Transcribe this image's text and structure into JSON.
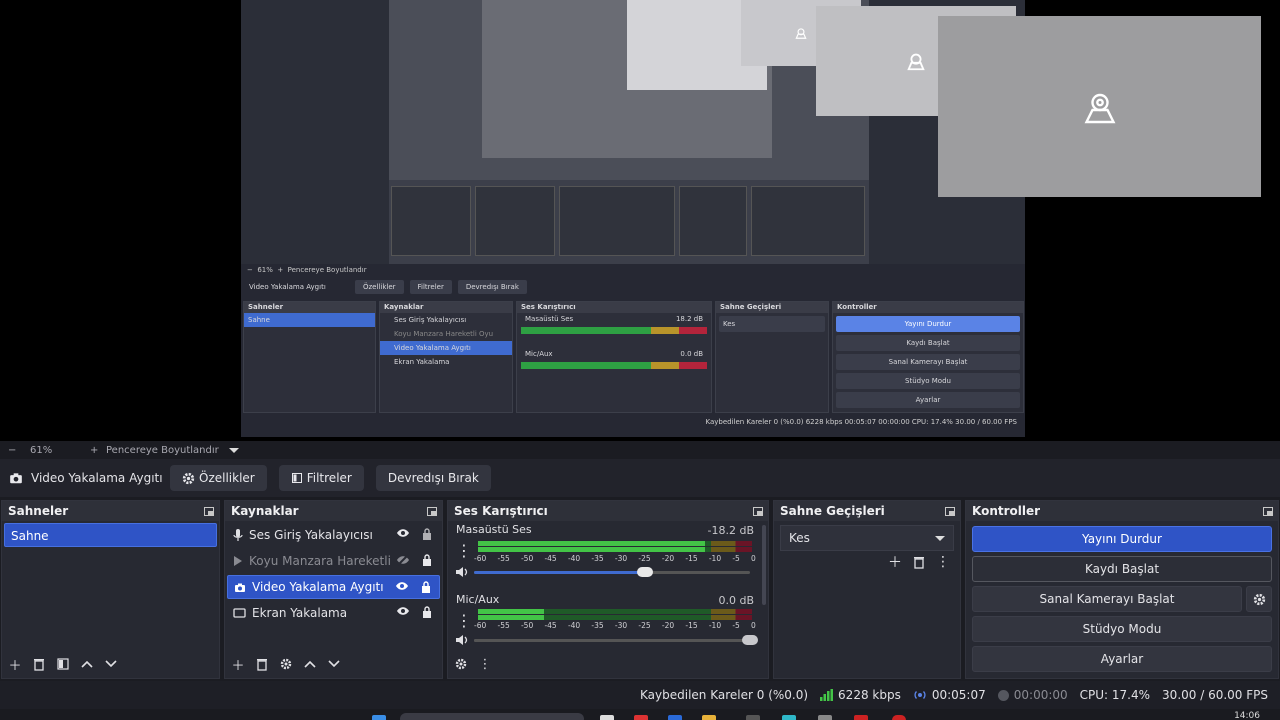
{
  "zoom_bar": {
    "minus": "−",
    "zoom": "61%",
    "plus": "+",
    "fit_label": "Pencereye Boyutlandır"
  },
  "context_bar": {
    "source_name": "Video Yakalama Aygıtı",
    "properties": "Özellikler",
    "filters": "Filtreler",
    "deactivate": "Devredışı Bırak"
  },
  "scenes": {
    "title": "Sahneler",
    "items": [
      "Sahne"
    ]
  },
  "sources": {
    "title": "Kaynaklar",
    "items": [
      {
        "label": "Ses Giriş Yakalayıcısı",
        "icon": "microphone-icon",
        "visible": true,
        "locked": true,
        "selected": false
      },
      {
        "label": "Koyu Manzara Hareketli Oyun",
        "icon": "play-icon",
        "visible": false,
        "locked": true,
        "selected": false
      },
      {
        "label": "Video Yakalama Aygıtı",
        "icon": "camera-icon",
        "visible": true,
        "locked": true,
        "selected": true
      },
      {
        "label": "Ekran Yakalama",
        "icon": "monitor-icon",
        "visible": true,
        "locked": true,
        "selected": false
      }
    ]
  },
  "mixer": {
    "title": "Ses Karıştırıcı",
    "scale": [
      "-60",
      "-55",
      "-50",
      "-45",
      "-40",
      "-35",
      "-30",
      "-25",
      "-20",
      "-15",
      "-10",
      "-5",
      "0"
    ],
    "tracks": [
      {
        "name": "Masaüstü Ses",
        "db": "-18.2 dB",
        "level": 0.83,
        "volume": 0.62
      },
      {
        "name": "Mic/Aux",
        "db": "0.0 dB",
        "level": 0.24,
        "volume": 1.0
      }
    ]
  },
  "transitions": {
    "title": "Sahne Geçişleri",
    "selected": "Kes"
  },
  "controls": {
    "title": "Kontroller",
    "stop_stream": "Yayını Durdur",
    "start_record": "Kaydı Başlat",
    "virtual_cam": "Sanal Kamerayı Başlat",
    "studio_mode": "Stüdyo Modu",
    "settings": "Ayarlar"
  },
  "status": {
    "dropped": "Kaybedilen Kareler 0 (%0.0)",
    "bitrate": "6228 kbps",
    "stream_time": "00:05:07",
    "record_time": "00:00:00",
    "cpu": "CPU: 17.4%",
    "fps": "30.00 / 60.00 FPS"
  },
  "taskbar": {
    "time": "14:06"
  },
  "mini": {
    "zoom": "61%",
    "fit": "Pencereye Boyutlandır",
    "source": "Video Yakalama Aygıtı",
    "properties": "Özellikler",
    "filters": "Filtreler",
    "deactivate": "Devredışı Bırak",
    "scenes": "Sahneler",
    "scene": "Sahne",
    "sources": "Kaynaklar",
    "mixer": "Ses Karıştırıcı",
    "transitions": "Sahne Geçişleri",
    "controls": "Kontroller",
    "src1": "Ses Giriş Yakalayıcısı",
    "src2": "Koyu Manzara Hareketli Oyu",
    "src3": "Video Yakalama Aygıtı",
    "src4": "Ekran Yakalama",
    "track1": "Masaüstü Ses",
    "track1_db": "18.2 dB",
    "track2": "Mic/Aux",
    "track2_db": "0.0 dB",
    "trans": "Kes",
    "stop": "Yayını Durdur",
    "record": "Kaydı Başlat",
    "vcam": "Sanal Kamerayı Başlat",
    "studio": "Stüdyo Modu",
    "settings": "Ayarlar",
    "status": "Kaybedilen Kareler 0 (%0.0)    6228 kbps    00:05:07    00:00:00    CPU: 17.4%    30.00 / 60.00 FPS"
  }
}
